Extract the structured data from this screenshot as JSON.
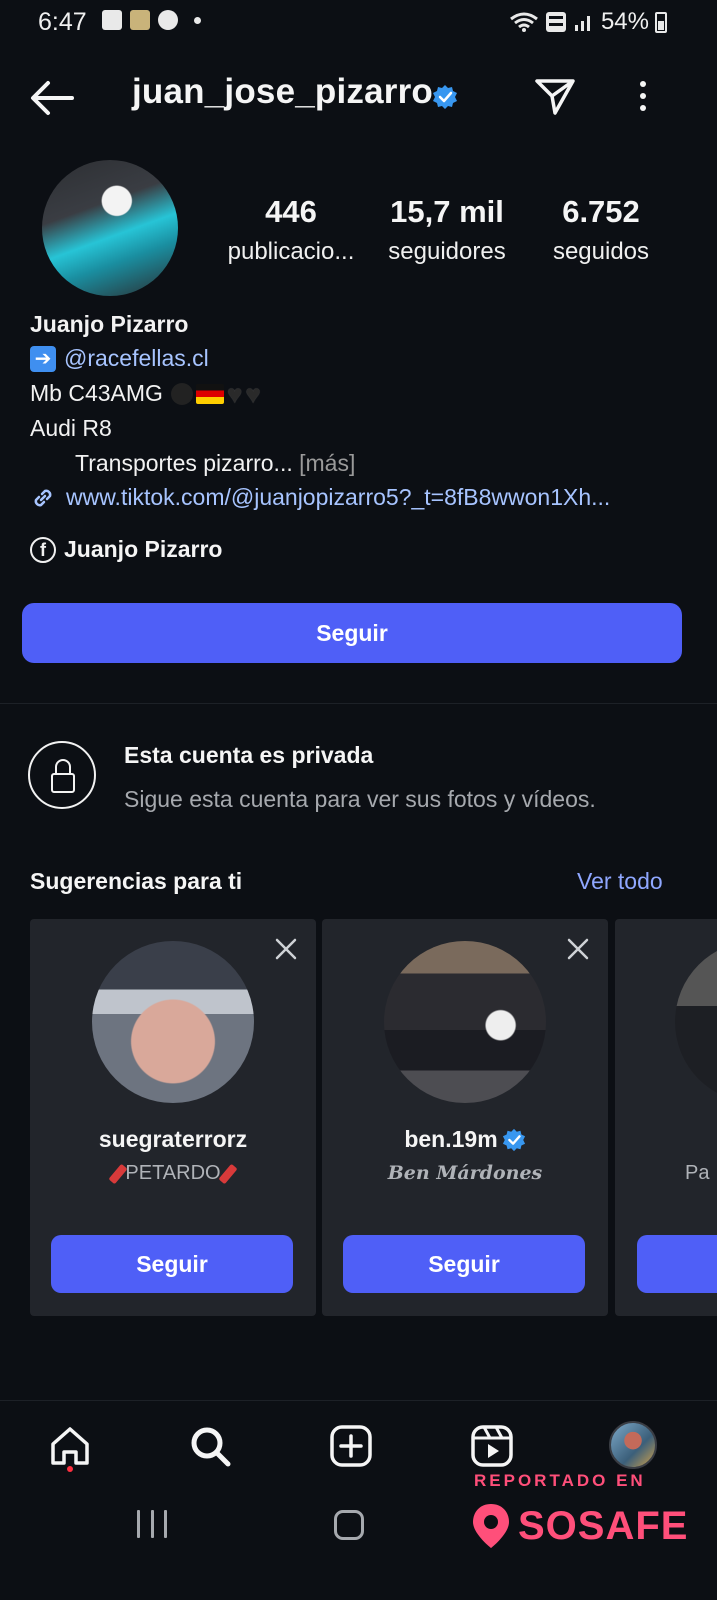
{
  "status_bar": {
    "time": "6:47",
    "battery": "54%",
    "icons": [
      "gallery-icon",
      "photo-icon",
      "pinterest-icon",
      "dot-icon",
      "wifi-icon",
      "vowifi-icon",
      "signal-icon",
      "battery-icon"
    ]
  },
  "header": {
    "username": "juan_jose_pizarro",
    "verified": true
  },
  "stats": [
    {
      "value": "446",
      "label": "publicacio..."
    },
    {
      "value": "15,7 mil",
      "label": "seguidores"
    },
    {
      "value": "6.752",
      "label": "seguidos"
    }
  ],
  "bio": {
    "name": "Juanjo Pizarro",
    "mention": "@racefellas.cl",
    "line3": "Mb C43AMG",
    "line4": "Audi R8",
    "line5": "Transportes pizarro...",
    "more": "[más]",
    "link": "www.tiktok.com/@juanjopizarro5?_t=8fB8wwon1Xh...",
    "facebook": "Juanjo Pizarro"
  },
  "follow_button": "Seguir",
  "private": {
    "title": "Esta cuenta es privada",
    "subtitle": "Sigue esta cuenta para ver sus fotos y vídeos."
  },
  "suggestions": {
    "title": "Sugerencias para ti",
    "see_all": "Ver todo",
    "cards": [
      {
        "name": "suegraterrorz",
        "subtitle": "PETARDO",
        "button": "Seguir",
        "verified": false
      },
      {
        "name": "ben.19m",
        "subtitle": "Ben Márdones",
        "button": "Seguir",
        "verified": true
      },
      {
        "name": "",
        "subtitle": "Pa",
        "button": "",
        "verified": false
      }
    ]
  },
  "watermark": {
    "top": "REPORTADO EN",
    "brand": "SOSAFE"
  },
  "colors": {
    "background": "#0c0f14",
    "accent": "#4f5ff7",
    "link": "#a7c4ff",
    "verified": "#3897f0",
    "watermark": "#ff4f7a"
  }
}
